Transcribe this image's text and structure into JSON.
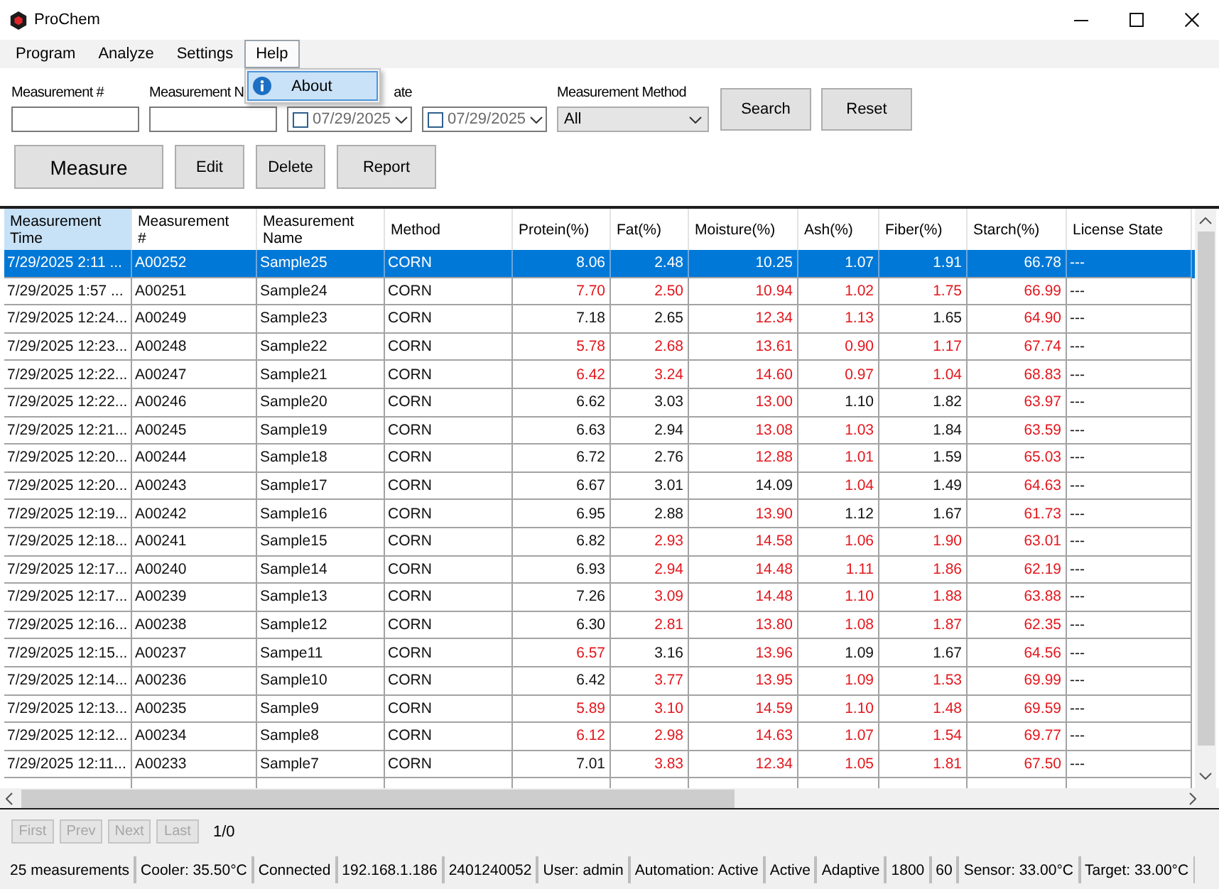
{
  "window": {
    "title": "ProChem"
  },
  "menu": [
    {
      "label": "Program",
      "open": false
    },
    {
      "label": "Analyze",
      "open": false
    },
    {
      "label": "Settings",
      "open": false
    },
    {
      "label": "Help",
      "open": true,
      "items": [
        {
          "label": "About",
          "selected": true
        }
      ]
    }
  ],
  "filters": [
    {
      "kind": "text",
      "label": "Measurement #"
    },
    {
      "kind": "text",
      "label": "Measurement N"
    },
    {
      "kind": "date",
      "label": "ate",
      "value": "07/29/2025",
      "checked": false
    },
    {
      "kind": "date",
      "value": "07/29/2025",
      "checked": false
    },
    {
      "kind": "combo",
      "label": "Measurement Method",
      "value": "All"
    }
  ],
  "filter_buttons": [
    "Search",
    "Reset"
  ],
  "actions": [
    {
      "label": "Measure",
      "kind": "large"
    },
    {
      "label": "Edit",
      "kind": "normal"
    },
    {
      "label": "Delete",
      "kind": "normal"
    },
    {
      "label": "Report",
      "kind": "normal"
    }
  ],
  "table": {
    "columns": [
      {
        "label": "Measurement Time",
        "kind": "text",
        "selected": true
      },
      {
        "label": "Measurement #",
        "kind": "text",
        "selected": false
      },
      {
        "label": "Measurement Name",
        "kind": "text",
        "selected": false
      },
      {
        "label": "Method",
        "kind": "text",
        "selected": false
      },
      {
        "label": "Protein(%)",
        "kind": "number",
        "selected": false
      },
      {
        "label": "Fat(%)",
        "kind": "number",
        "selected": false
      },
      {
        "label": "Moisture(%)",
        "kind": "number",
        "selected": false
      },
      {
        "label": "Ash(%)",
        "kind": "number",
        "selected": false
      },
      {
        "label": "Fiber(%)",
        "kind": "number",
        "selected": false
      },
      {
        "label": "Starch(%)",
        "kind": "number",
        "selected": false
      },
      {
        "label": "License State",
        "kind": "text",
        "selected": false
      }
    ],
    "rows": [
      {
        "selected": true,
        "cells": [
          "7/29/2025 2:11 ...",
          "A00252",
          "Sample25",
          "CORN",
          {
            "value": "8.06"
          },
          {
            "value": "2.48"
          },
          {
            "value": "10.25"
          },
          {
            "value": "1.07"
          },
          {
            "value": "1.91"
          },
          {
            "value": "66.78"
          },
          "---"
        ]
      },
      {
        "selected": false,
        "cells": [
          "7/29/2025 1:57 ...",
          "A00251",
          "Sample24",
          "CORN",
          {
            "value": "7.70",
            "flagged": true
          },
          {
            "value": "2.50",
            "flagged": true
          },
          {
            "value": "10.94",
            "flagged": true
          },
          {
            "value": "1.02",
            "flagged": true
          },
          {
            "value": "1.75",
            "flagged": true
          },
          {
            "value": "66.99",
            "flagged": true
          },
          "---"
        ]
      },
      {
        "selected": false,
        "cells": [
          "7/29/2025 12:24...",
          "A00249",
          "Sample23",
          "CORN",
          {
            "value": "7.18",
            "flagged": false
          },
          {
            "value": "2.65",
            "flagged": false
          },
          {
            "value": "12.34",
            "flagged": true
          },
          {
            "value": "1.13",
            "flagged": true
          },
          {
            "value": "1.65",
            "flagged": false
          },
          {
            "value": "64.90",
            "flagged": true
          },
          "---"
        ]
      },
      {
        "selected": false,
        "cells": [
          "7/29/2025 12:23...",
          "A00248",
          "Sample22",
          "CORN",
          {
            "value": "5.78",
            "flagged": true
          },
          {
            "value": "2.68",
            "flagged": true
          },
          {
            "value": "13.61",
            "flagged": true
          },
          {
            "value": "0.90",
            "flagged": true
          },
          {
            "value": "1.17",
            "flagged": true
          },
          {
            "value": "67.74",
            "flagged": true
          },
          "---"
        ]
      },
      {
        "selected": false,
        "cells": [
          "7/29/2025 12:22...",
          "A00247",
          "Sample21",
          "CORN",
          {
            "value": "6.42",
            "flagged": true
          },
          {
            "value": "3.24",
            "flagged": true
          },
          {
            "value": "14.60",
            "flagged": true
          },
          {
            "value": "0.97",
            "flagged": true
          },
          {
            "value": "1.04",
            "flagged": true
          },
          {
            "value": "68.83",
            "flagged": true
          },
          "---"
        ]
      },
      {
        "selected": false,
        "cells": [
          "7/29/2025 12:22...",
          "A00246",
          "Sample20",
          "CORN",
          {
            "value": "6.62",
            "flagged": false
          },
          {
            "value": "3.03",
            "flagged": false
          },
          {
            "value": "13.00",
            "flagged": true
          },
          {
            "value": "1.10",
            "flagged": false
          },
          {
            "value": "1.82",
            "flagged": false
          },
          {
            "value": "63.97",
            "flagged": true
          },
          "---"
        ]
      },
      {
        "selected": false,
        "cells": [
          "7/29/2025 12:21...",
          "A00245",
          "Sample19",
          "CORN",
          {
            "value": "6.63",
            "flagged": false
          },
          {
            "value": "2.94",
            "flagged": false
          },
          {
            "value": "13.08",
            "flagged": true
          },
          {
            "value": "1.03",
            "flagged": true
          },
          {
            "value": "1.84",
            "flagged": false
          },
          {
            "value": "63.59",
            "flagged": true
          },
          "---"
        ]
      },
      {
        "selected": false,
        "cells": [
          "7/29/2025 12:20...",
          "A00244",
          "Sample18",
          "CORN",
          {
            "value": "6.72",
            "flagged": false
          },
          {
            "value": "2.76",
            "flagged": false
          },
          {
            "value": "12.88",
            "flagged": true
          },
          {
            "value": "1.01",
            "flagged": true
          },
          {
            "value": "1.59",
            "flagged": false
          },
          {
            "value": "65.03",
            "flagged": true
          },
          "---"
        ]
      },
      {
        "selected": false,
        "cells": [
          "7/29/2025 12:20...",
          "A00243",
          "Sample17",
          "CORN",
          {
            "value": "6.67",
            "flagged": false
          },
          {
            "value": "3.01",
            "flagged": false
          },
          {
            "value": "14.09",
            "flagged": false
          },
          {
            "value": "1.04",
            "flagged": true
          },
          {
            "value": "1.49",
            "flagged": false
          },
          {
            "value": "64.63",
            "flagged": true
          },
          "---"
        ]
      },
      {
        "selected": false,
        "cells": [
          "7/29/2025 12:19...",
          "A00242",
          "Sample16",
          "CORN",
          {
            "value": "6.95",
            "flagged": false
          },
          {
            "value": "2.88",
            "flagged": false
          },
          {
            "value": "13.90",
            "flagged": true
          },
          {
            "value": "1.12",
            "flagged": false
          },
          {
            "value": "1.67",
            "flagged": false
          },
          {
            "value": "61.73",
            "flagged": true
          },
          "---"
        ]
      },
      {
        "selected": false,
        "cells": [
          "7/29/2025 12:18...",
          "A00241",
          "Sample15",
          "CORN",
          {
            "value": "6.82",
            "flagged": false
          },
          {
            "value": "2.93",
            "flagged": true
          },
          {
            "value": "14.58",
            "flagged": true
          },
          {
            "value": "1.06",
            "flagged": true
          },
          {
            "value": "1.90",
            "flagged": true
          },
          {
            "value": "63.01",
            "flagged": true
          },
          "---"
        ]
      },
      {
        "selected": false,
        "cells": [
          "7/29/2025 12:17...",
          "A00240",
          "Sample14",
          "CORN",
          {
            "value": "6.93",
            "flagged": false
          },
          {
            "value": "2.94",
            "flagged": true
          },
          {
            "value": "14.48",
            "flagged": true
          },
          {
            "value": "1.11",
            "flagged": true
          },
          {
            "value": "1.86",
            "flagged": true
          },
          {
            "value": "62.19",
            "flagged": true
          },
          "---"
        ]
      },
      {
        "selected": false,
        "cells": [
          "7/29/2025 12:17...",
          "A00239",
          "Sample13",
          "CORN",
          {
            "value": "7.26",
            "flagged": false
          },
          {
            "value": "3.09",
            "flagged": true
          },
          {
            "value": "14.48",
            "flagged": true
          },
          {
            "value": "1.10",
            "flagged": true
          },
          {
            "value": "1.88",
            "flagged": true
          },
          {
            "value": "63.88",
            "flagged": true
          },
          "---"
        ]
      },
      {
        "selected": false,
        "cells": [
          "7/29/2025 12:16...",
          "A00238",
          "Sample12",
          "CORN",
          {
            "value": "6.30",
            "flagged": false
          },
          {
            "value": "2.81",
            "flagged": true
          },
          {
            "value": "13.80",
            "flagged": true
          },
          {
            "value": "1.08",
            "flagged": true
          },
          {
            "value": "1.87",
            "flagged": true
          },
          {
            "value": "62.35",
            "flagged": true
          },
          "---"
        ]
      },
      {
        "selected": false,
        "cells": [
          "7/29/2025 12:15...",
          "A00237",
          "Sampe11",
          "CORN",
          {
            "value": "6.57",
            "flagged": true
          },
          {
            "value": "3.16",
            "flagged": false
          },
          {
            "value": "13.96",
            "flagged": true
          },
          {
            "value": "1.09",
            "flagged": false
          },
          {
            "value": "1.67",
            "flagged": false
          },
          {
            "value": "64.56",
            "flagged": true
          },
          "---"
        ]
      },
      {
        "selected": false,
        "cells": [
          "7/29/2025 12:14...",
          "A00236",
          "Sample10",
          "CORN",
          {
            "value": "6.42",
            "flagged": false
          },
          {
            "value": "3.77",
            "flagged": true
          },
          {
            "value": "13.95",
            "flagged": true
          },
          {
            "value": "1.09",
            "flagged": true
          },
          {
            "value": "1.53",
            "flagged": true
          },
          {
            "value": "69.99",
            "flagged": true
          },
          "---"
        ]
      },
      {
        "selected": false,
        "cells": [
          "7/29/2025 12:13...",
          "A00235",
          "Sample9",
          "CORN",
          {
            "value": "5.89",
            "flagged": true
          },
          {
            "value": "3.10",
            "flagged": true
          },
          {
            "value": "14.59",
            "flagged": true
          },
          {
            "value": "1.10",
            "flagged": true
          },
          {
            "value": "1.48",
            "flagged": true
          },
          {
            "value": "69.59",
            "flagged": true
          },
          "---"
        ]
      },
      {
        "selected": false,
        "cells": [
          "7/29/2025 12:12...",
          "A00234",
          "Sample8",
          "CORN",
          {
            "value": "6.12",
            "flagged": true
          },
          {
            "value": "2.98",
            "flagged": true
          },
          {
            "value": "14.63",
            "flagged": true
          },
          {
            "value": "1.07",
            "flagged": true
          },
          {
            "value": "1.54",
            "flagged": true
          },
          {
            "value": "69.77",
            "flagged": true
          },
          "---"
        ]
      },
      {
        "selected": false,
        "cells": [
          "7/29/2025 12:11...",
          "A00233",
          "Sample7",
          "CORN",
          {
            "value": "7.01",
            "flagged": false
          },
          {
            "value": "3.83",
            "flagged": true
          },
          {
            "value": "12.34",
            "flagged": true
          },
          {
            "value": "1.05",
            "flagged": true
          },
          {
            "value": "1.81",
            "flagged": true
          },
          {
            "value": "67.50",
            "flagged": true
          },
          "---"
        ]
      }
    ]
  },
  "pager": {
    "buttons": [
      {
        "label": "First",
        "disabled": true
      },
      {
        "label": "Prev",
        "disabled": true
      },
      {
        "label": "Next",
        "disabled": true
      },
      {
        "label": "Last",
        "disabled": true
      }
    ],
    "page": "1/0"
  },
  "status_bar": [
    "25 measurements",
    "Cooler: 35.50°C",
    "Connected",
    "192.168.1.186",
    "2401240052",
    "User: admin",
    "Automation: Active",
    "Active",
    "Adaptive",
    "1800",
    "60",
    "Sensor: 33.00°C",
    "Target: 33.00°C"
  ]
}
